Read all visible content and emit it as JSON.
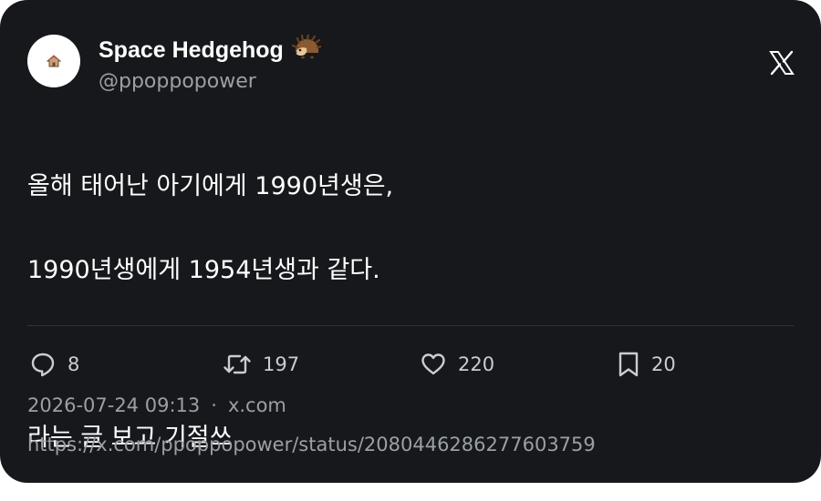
{
  "author": {
    "display_name": "Space Hedgehog",
    "handle": "@ppoppopower",
    "name_emoji": "hedgehog-icon",
    "avatar": "avatar-house-icon"
  },
  "platform": {
    "logo": "x-logo-icon"
  },
  "tweet": {
    "lines": [
      "올해 태어난 아기에게 1990년생은,",
      "1990년생에게 1954년생과 같다.",
      "",
      "라는 글 보고 기절쓰"
    ]
  },
  "actions": {
    "reply_count": "8",
    "retweet_count": "197",
    "like_count": "220",
    "bookmark_count": "20"
  },
  "meta": {
    "timestamp": "2026-07-24 09:13",
    "separator": "·",
    "source": "x.com",
    "url": "https://x.com/ppoppopower/status/2080446286277603759"
  },
  "colors": {
    "card_background": "#16181c",
    "primary_text": "#ffffff",
    "secondary_text": "#9aa0a5",
    "divider": "#2f3336"
  }
}
